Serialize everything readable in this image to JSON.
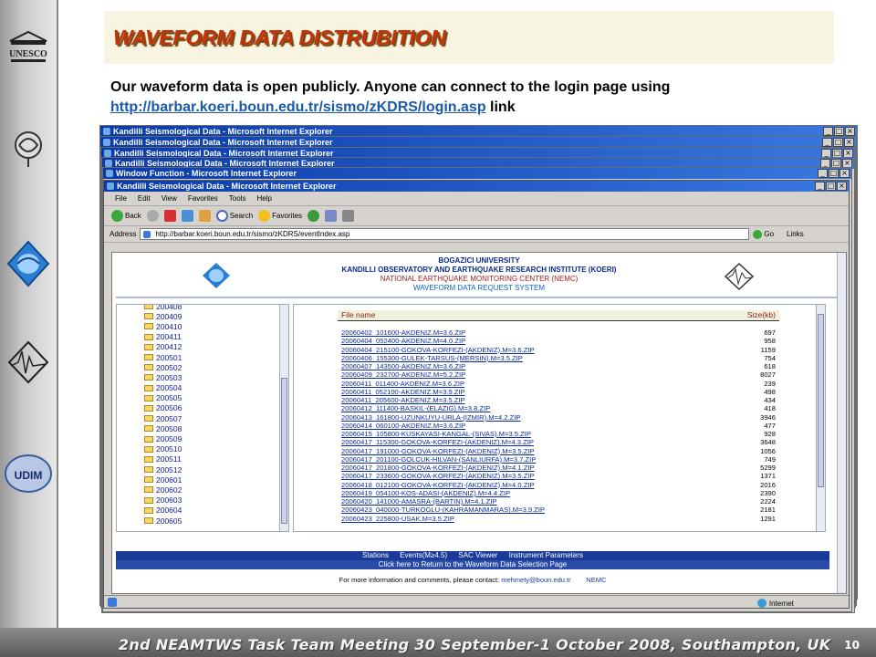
{
  "slide": {
    "title": "WAVEFORM DATA DISTRUBITION",
    "subtitle_line1": "Our waveform data is open publicly. Anyone can connect to the login page using",
    "login_url": "http://barbar.koeri.boun.edu.tr/sismo/zKDRS/login.asp",
    "subtitle_link_suffix": " link",
    "footer": "2nd NEAMTWS Task Team Meeting 30 September-1 October 2008, Southampton, UK",
    "page_number": "10",
    "logos": [
      "UNESCO",
      "emblem",
      "globe-logo",
      "seismograph-logo",
      "UDIM"
    ]
  },
  "windows": [
    {
      "title": "Kandilli Seismological Data - Microsoft Internet Explorer"
    },
    {
      "title": "Kandilli Seismological Data - Microsoft Internet Explorer"
    },
    {
      "title": "Kandilli Seismological Data - Microsoft Internet Explorer"
    },
    {
      "title": "Kandilli Seismological Data - Microsoft Internet Explorer"
    },
    {
      "title": "Window Function - Microsoft Internet Explorer"
    },
    {
      "title": "Kandilli Seismological Data - Microsoft Internet Explorer"
    }
  ],
  "browser": {
    "menu": [
      "File",
      "Edit",
      "View",
      "Favorites",
      "Tools",
      "Help"
    ],
    "toolbar": {
      "back": "Back",
      "search": "Search",
      "favorites": "Favorites"
    },
    "address_label": "Address",
    "address": "http://barbar.koeri.boun.edu.tr/sismo/zKDRS/eventIndex.asp",
    "go": "Go",
    "links": "Links",
    "status": "Internet"
  },
  "page": {
    "org1": "BOGAZICI UNIVERSITY",
    "org2": "KANDILLI OBSERVATORY AND EARTHQUAKE RESEARCH INSTITUTE (KOERI)",
    "org3": "NATIONAL EARTHQUAKE MONITORING CENTER (NEMC)",
    "org4": "WAVEFORM DATA REQUEST SYSTEM",
    "folders": [
      "200408",
      "200409",
      "200410",
      "200411",
      "200412",
      "200501",
      "200502",
      "200503",
      "200504",
      "200505",
      "200506",
      "200507",
      "200508",
      "200509",
      "200510",
      "200511",
      "200512",
      "200601",
      "200602",
      "200603",
      "200604",
      "200605"
    ],
    "file_header": {
      "name": "File name",
      "size": "Size(kb)"
    },
    "files": [
      {
        "name": "20060402_101600-AKDENIZ.M=3.6.ZIP",
        "size": "697"
      },
      {
        "name": "20060404_052400-AKDENIZ.M=4.0.ZIP",
        "size": "958"
      },
      {
        "name": "20060404_215100-GOKOVA-KORFEZI-(AKDENIZ).M=3.6.ZIP",
        "size": "1159"
      },
      {
        "name": "20060406_155300-GULEK-TARSUS-(MERSIN).M=3.5.ZIP",
        "size": "754"
      },
      {
        "name": "20060407_143500-AKDENIZ.M=3.6.ZIP",
        "size": "618"
      },
      {
        "name": "20060409_232700-AKDENIZ.M=5.2.ZIP",
        "size": "8027"
      },
      {
        "name": "20060411_011400-AKDENIZ.M=3.6.ZIP",
        "size": "239"
      },
      {
        "name": "20060411_052100-AKDENIZ.M=3.9.ZIP",
        "size": "498"
      },
      {
        "name": "20060411_205600-AKDENIZ.M=3.5.ZIP",
        "size": "434"
      },
      {
        "name": "20060412_111400-BASKIL-(ELAZIG).M=3.8.ZIP",
        "size": "418"
      },
      {
        "name": "20060413_161800-UZUNKUYU-URLA-(IZMIR).M=4.2.ZIP",
        "size": "3946"
      },
      {
        "name": "20060414_060100-AKDENIZ.M=3.6.ZIP",
        "size": "477"
      },
      {
        "name": "20060415_105800-KUSKAYASI-KANGAL-(SIVAS).M=3.5.ZIP",
        "size": "928"
      },
      {
        "name": "20060417_115300-GOKOVA-KORFEZI-(AKDENIZ).M=4.3.ZIP",
        "size": "3648"
      },
      {
        "name": "20060417_191000-GOKOVA-KORFEZI-(AKDENIZ).M=3.5.ZIP",
        "size": "1056"
      },
      {
        "name": "20060417_201100-GOLCUK-HILVAN-(SANLIURFA).M=3.7.ZIP",
        "size": "749"
      },
      {
        "name": "20060417_201800-GOKOVA-KORFEZI-(AKDENIZ).M=4.1.ZIP",
        "size": "5299"
      },
      {
        "name": "20060417_233600-GOKOVA-KORFEZI-(AKDENIZ).M=3.5.ZIP",
        "size": "1371"
      },
      {
        "name": "20060418_012100-GOKOVA-KORFEZI-(AKDENIZ).M=4.0.ZIP",
        "size": "2016"
      },
      {
        "name": "20060419_054100-KOS-ADASI-(AKDENIZ).M=4.4.ZIP",
        "size": "2390"
      },
      {
        "name": "20060420_141000-AMASRA-(BARTIN).M=4.1.ZIP",
        "size": "2224"
      },
      {
        "name": "20060423_040000-TURKOGLU-(KAHRAMANMARAS).M=3.9.ZIP",
        "size": "2181"
      },
      {
        "name": "20060423_225800-USAK.M=3.5.ZIP",
        "size": "1291"
      }
    ],
    "nav_links": [
      "Stations",
      "Events(M≥4.5)",
      "SAC Viewer",
      "Instrument Parameters"
    ],
    "return_link": "Click here to Return to the Waveform Data Selection Page",
    "info_prefix": "For more information and comments, please contact:",
    "info_email": "mehmety@boun.edu.tr",
    "info_org": "NEMC"
  }
}
